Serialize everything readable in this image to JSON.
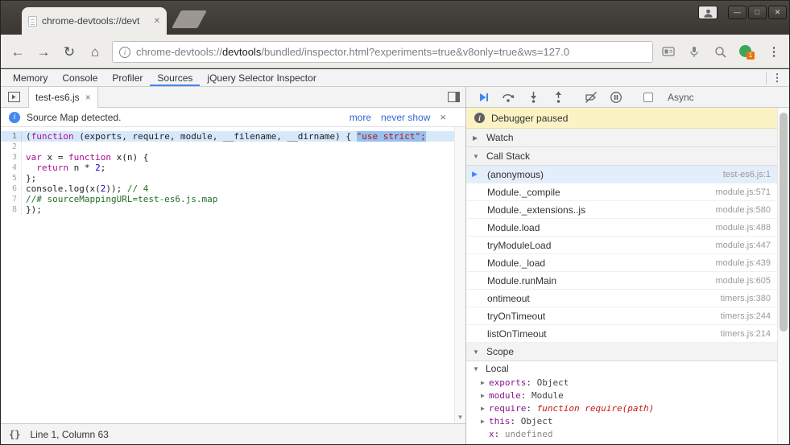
{
  "colors": {
    "accent_blue": "#4285f4",
    "paused_yellow": "#fcf3c5",
    "selection_blue": "#96c0f0",
    "current_line_blue": "#d7e8fb",
    "extension_green": "#3aa757",
    "badge_orange": "#e8710a"
  },
  "icons": {
    "back": "←",
    "forward": "→",
    "reload": "↻",
    "home": "⌂",
    "site_info": "i",
    "browser_menu": "⋮",
    "devtools_menu": "⋮",
    "tab_close": "✕",
    "file_tab_close": "×",
    "infobar_close": "×",
    "infobar_info": "i",
    "paused_info": "i",
    "minimize": "—",
    "maximize": "□",
    "close": "✕",
    "braces": "{}",
    "scroll_down": "▼",
    "collapsed_triangle": "▶",
    "expanded_triangle": "▼",
    "active_frame_marker": "▶",
    "extension_badge_count": "1"
  },
  "titlebar": {
    "tab_title": "chrome-devtools://devt"
  },
  "browser": {
    "url": {
      "scheme": "chrome-devtools://",
      "host": "devtools",
      "path": "/bundled/inspector.html?experiments=true&v8only=true&ws=127.0"
    }
  },
  "devtools": {
    "tabs": [
      {
        "label": "Memory",
        "active": false
      },
      {
        "label": "Console",
        "active": false
      },
      {
        "label": "Profiler",
        "active": false
      },
      {
        "label": "Sources",
        "active": true
      },
      {
        "label": "jQuery Selector Inspector",
        "active": false
      }
    ]
  },
  "sources": {
    "file_tab_label": "test-es6.js",
    "notice": {
      "text": "Source Map detected.",
      "more_link": "more",
      "never_show_link": "never show"
    },
    "status_text": "Line 1, Column 63",
    "code": {
      "lines": [
        {
          "n": 1,
          "current": true,
          "segments": [
            {
              "t": "(",
              "c": "plain"
            },
            {
              "t": "function",
              "c": "keyword"
            },
            {
              "t": " (exports, require, module, __filename, __dirname) { ",
              "c": "plain"
            },
            {
              "t": "\"use strict\";",
              "c": "string-sel"
            }
          ]
        },
        {
          "n": 2,
          "current": false,
          "segments": []
        },
        {
          "n": 3,
          "current": false,
          "segments": [
            {
              "t": "var",
              "c": "keyword"
            },
            {
              "t": " x = ",
              "c": "plain"
            },
            {
              "t": "function",
              "c": "keyword"
            },
            {
              "t": " x(n) {",
              "c": "plain"
            }
          ]
        },
        {
          "n": 4,
          "current": false,
          "segments": [
            {
              "t": "  ",
              "c": "plain"
            },
            {
              "t": "return",
              "c": "keyword"
            },
            {
              "t": " n * ",
              "c": "plain"
            },
            {
              "t": "2",
              "c": "number"
            },
            {
              "t": ";",
              "c": "plain"
            }
          ]
        },
        {
          "n": 5,
          "current": false,
          "segments": [
            {
              "t": "};",
              "c": "plain"
            }
          ]
        },
        {
          "n": 6,
          "current": false,
          "segments": [
            {
              "t": "console.log(x(",
              "c": "plain"
            },
            {
              "t": "2",
              "c": "number"
            },
            {
              "t": ")); ",
              "c": "plain"
            },
            {
              "t": "// 4",
              "c": "comment"
            }
          ]
        },
        {
          "n": 7,
          "current": false,
          "segments": [
            {
              "t": "//# sourceMappingURL=test-es6.js.map",
              "c": "comment"
            }
          ]
        },
        {
          "n": 8,
          "current": false,
          "segments": [
            {
              "t": "});",
              "c": "plain"
            }
          ]
        }
      ]
    }
  },
  "debugger": {
    "paused_text": "Debugger paused",
    "async_label": "Async",
    "async_checked": false,
    "sections": {
      "watch": "Watch",
      "call_stack": "Call Stack",
      "scope": "Scope",
      "local": "Local"
    },
    "call_stack": [
      {
        "name": "(anonymous)",
        "location": "test-es6.js:1",
        "active": true
      },
      {
        "name": "Module._compile",
        "location": "module.js:571",
        "active": false
      },
      {
        "name": "Module._extensions..js",
        "location": "module.js:580",
        "active": false
      },
      {
        "name": "Module.load",
        "location": "module.js:488",
        "active": false
      },
      {
        "name": "tryModuleLoad",
        "location": "module.js:447",
        "active": false
      },
      {
        "name": "Module._load",
        "location": "module.js:439",
        "active": false
      },
      {
        "name": "Module.runMain",
        "location": "module.js:605",
        "active": false
      },
      {
        "name": "ontimeout",
        "location": "timers.js:380",
        "active": false
      },
      {
        "name": "tryOnTimeout",
        "location": "timers.js:244",
        "active": false
      },
      {
        "name": "listOnTimeout",
        "location": "timers.js:214",
        "active": false
      }
    ],
    "scope": {
      "entries": [
        {
          "name": "exports",
          "value": "Object",
          "vtype": "object",
          "expandable": true
        },
        {
          "name": "module",
          "value": "Module",
          "vtype": "object",
          "expandable": true
        },
        {
          "name": "require",
          "value": "function require(path)",
          "vtype": "function",
          "expandable": true
        },
        {
          "name": "this",
          "value": "Object",
          "vtype": "object",
          "expandable": true
        },
        {
          "name": "x",
          "value": "undefined",
          "vtype": "undefined",
          "expandable": false
        }
      ]
    }
  }
}
